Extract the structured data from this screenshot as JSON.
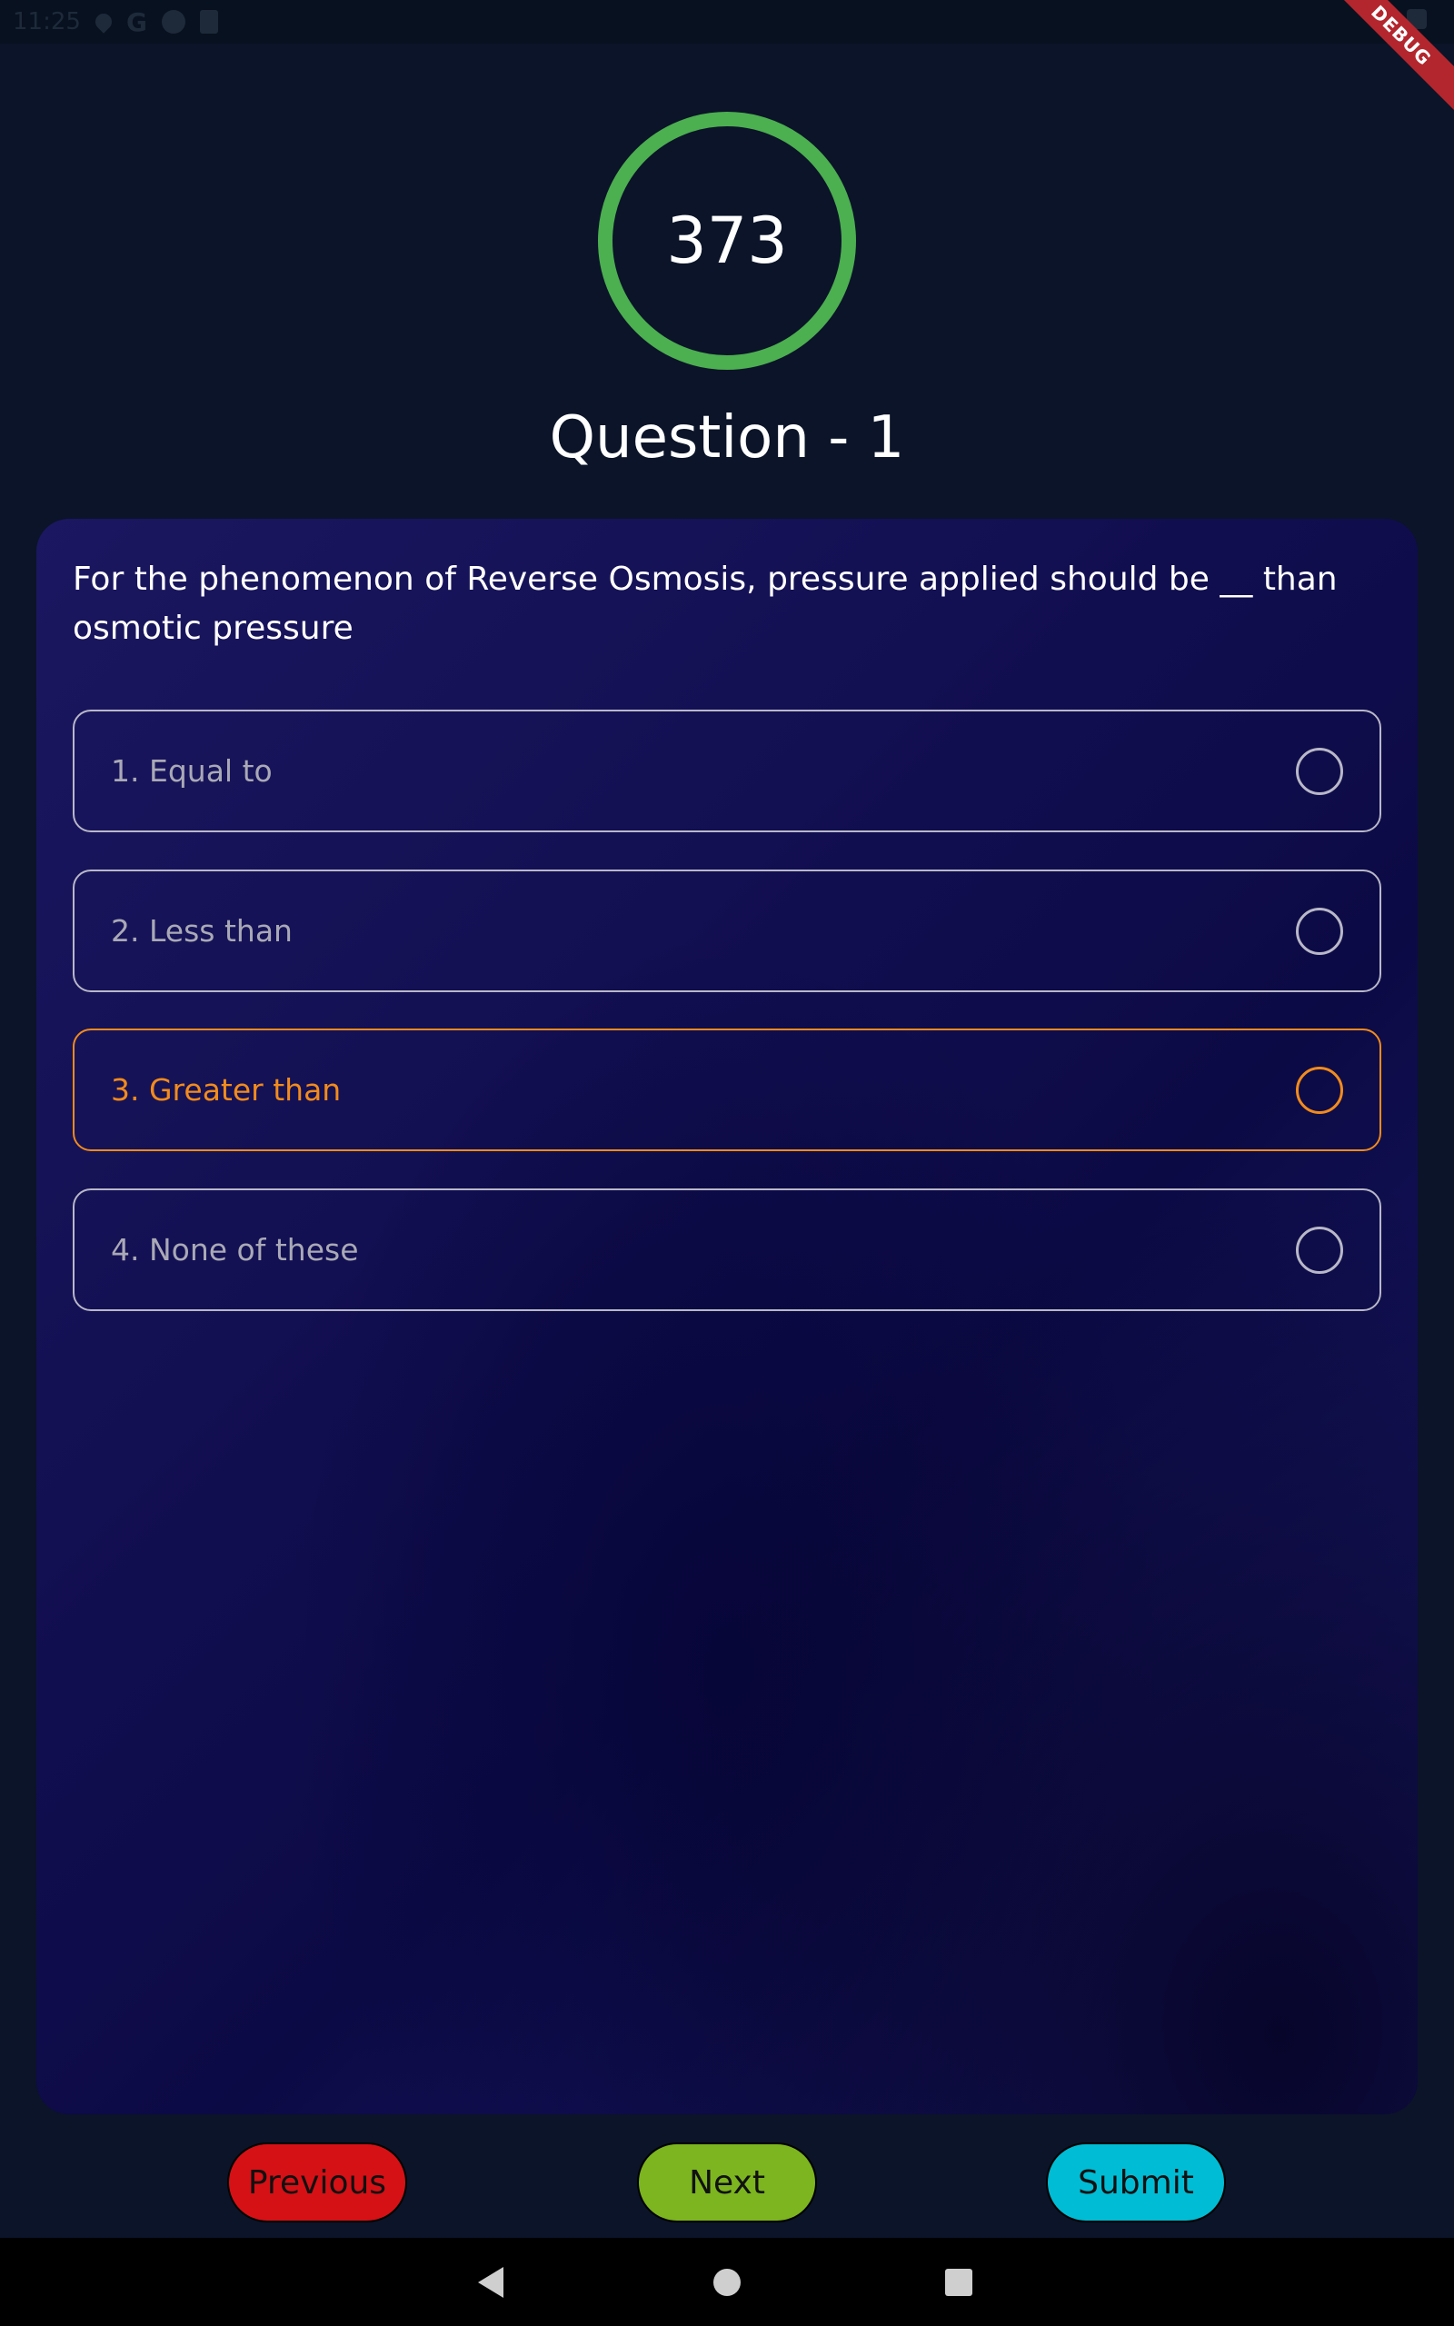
{
  "status_bar": {
    "time": "11:25",
    "icons": [
      "location-icon",
      "google-icon",
      "app-icon",
      "sd-card-icon",
      "wifi-icon",
      "battery-icon"
    ]
  },
  "debug_banner": "DEBUG",
  "timer": {
    "value": "373",
    "color": "#4caf50"
  },
  "question": {
    "title": "Question - 1",
    "text": "For the phenomenon of Reverse Osmosis, pressure applied should be __ than osmotic pressure"
  },
  "options": [
    {
      "label": "1. Equal to",
      "selected": false
    },
    {
      "label": "2. Less than",
      "selected": false
    },
    {
      "label": "3. Greater than",
      "selected": true
    },
    {
      "label": "4. None of these",
      "selected": false
    }
  ],
  "buttons": {
    "previous": "Previous",
    "next": "Next",
    "submit": "Submit"
  },
  "colors": {
    "background": "#0b1428",
    "selected_accent": "#f28b1c",
    "previous_button": "#d51116",
    "next_button": "#7cb51f",
    "submit_button": "#00bcd4"
  },
  "nav_bar": {
    "icons": [
      "back-icon",
      "home-icon",
      "recents-icon"
    ]
  }
}
